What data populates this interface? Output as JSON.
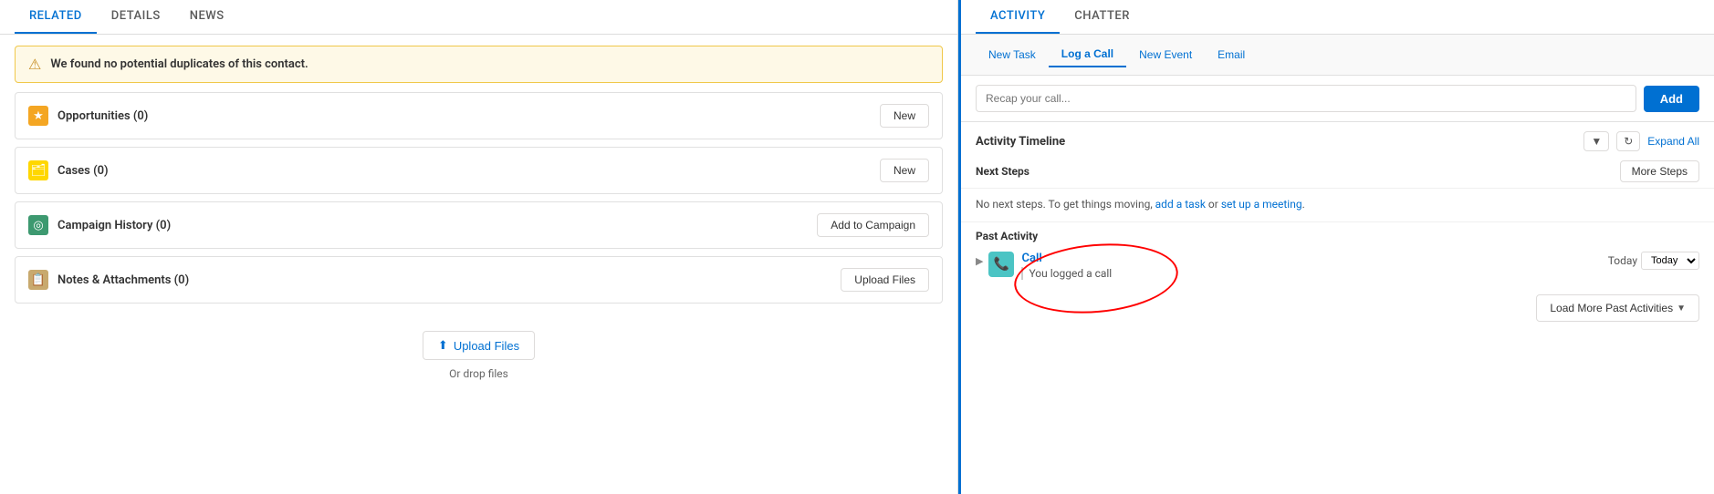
{
  "left": {
    "tabs": [
      {
        "label": "RELATED",
        "active": true
      },
      {
        "label": "DETAILS",
        "active": false
      },
      {
        "label": "NEWS",
        "active": false
      }
    ],
    "alert": {
      "text": "We found no potential duplicates of this contact."
    },
    "sections": [
      {
        "id": "opportunities",
        "icon": "★",
        "iconClass": "icon-orange",
        "title": "Opportunities (0)",
        "btn": "New"
      },
      {
        "id": "cases",
        "icon": "🗂",
        "iconClass": "icon-yellow",
        "title": "Cases (0)",
        "btn": "New"
      },
      {
        "id": "campaign",
        "icon": "◎",
        "iconClass": "icon-teal",
        "title": "Campaign History (0)",
        "btn": "Add to Campaign"
      },
      {
        "id": "notes",
        "icon": "📋",
        "iconClass": "icon-tan",
        "title": "Notes & Attachments (0)",
        "btn": "Upload Files"
      }
    ],
    "upload": {
      "btn_label": "Upload Files",
      "drop_label": "Or drop files"
    }
  },
  "right": {
    "tabs": [
      {
        "label": "ACTIVITY",
        "active": true
      },
      {
        "label": "CHATTER",
        "active": false
      }
    ],
    "activity_tabs": [
      {
        "label": "New Task",
        "active": false
      },
      {
        "label": "Log a Call",
        "active": true
      },
      {
        "label": "New Event",
        "active": false
      },
      {
        "label": "Email",
        "active": false
      }
    ],
    "recap_placeholder": "Recap your call...",
    "add_btn": "Add",
    "timeline_title": "Activity Timeline",
    "expand_all": "Expand All",
    "next_steps_label": "Next Steps",
    "more_steps_btn": "More Steps",
    "no_steps_text": "No next steps. To get things moving, add a task or set up a meeting.",
    "past_activity_label": "Past Activity",
    "call": {
      "title": "Call",
      "sub": "You logged a call",
      "date": "Today"
    },
    "load_more_btn": "Load More Past Activities"
  }
}
